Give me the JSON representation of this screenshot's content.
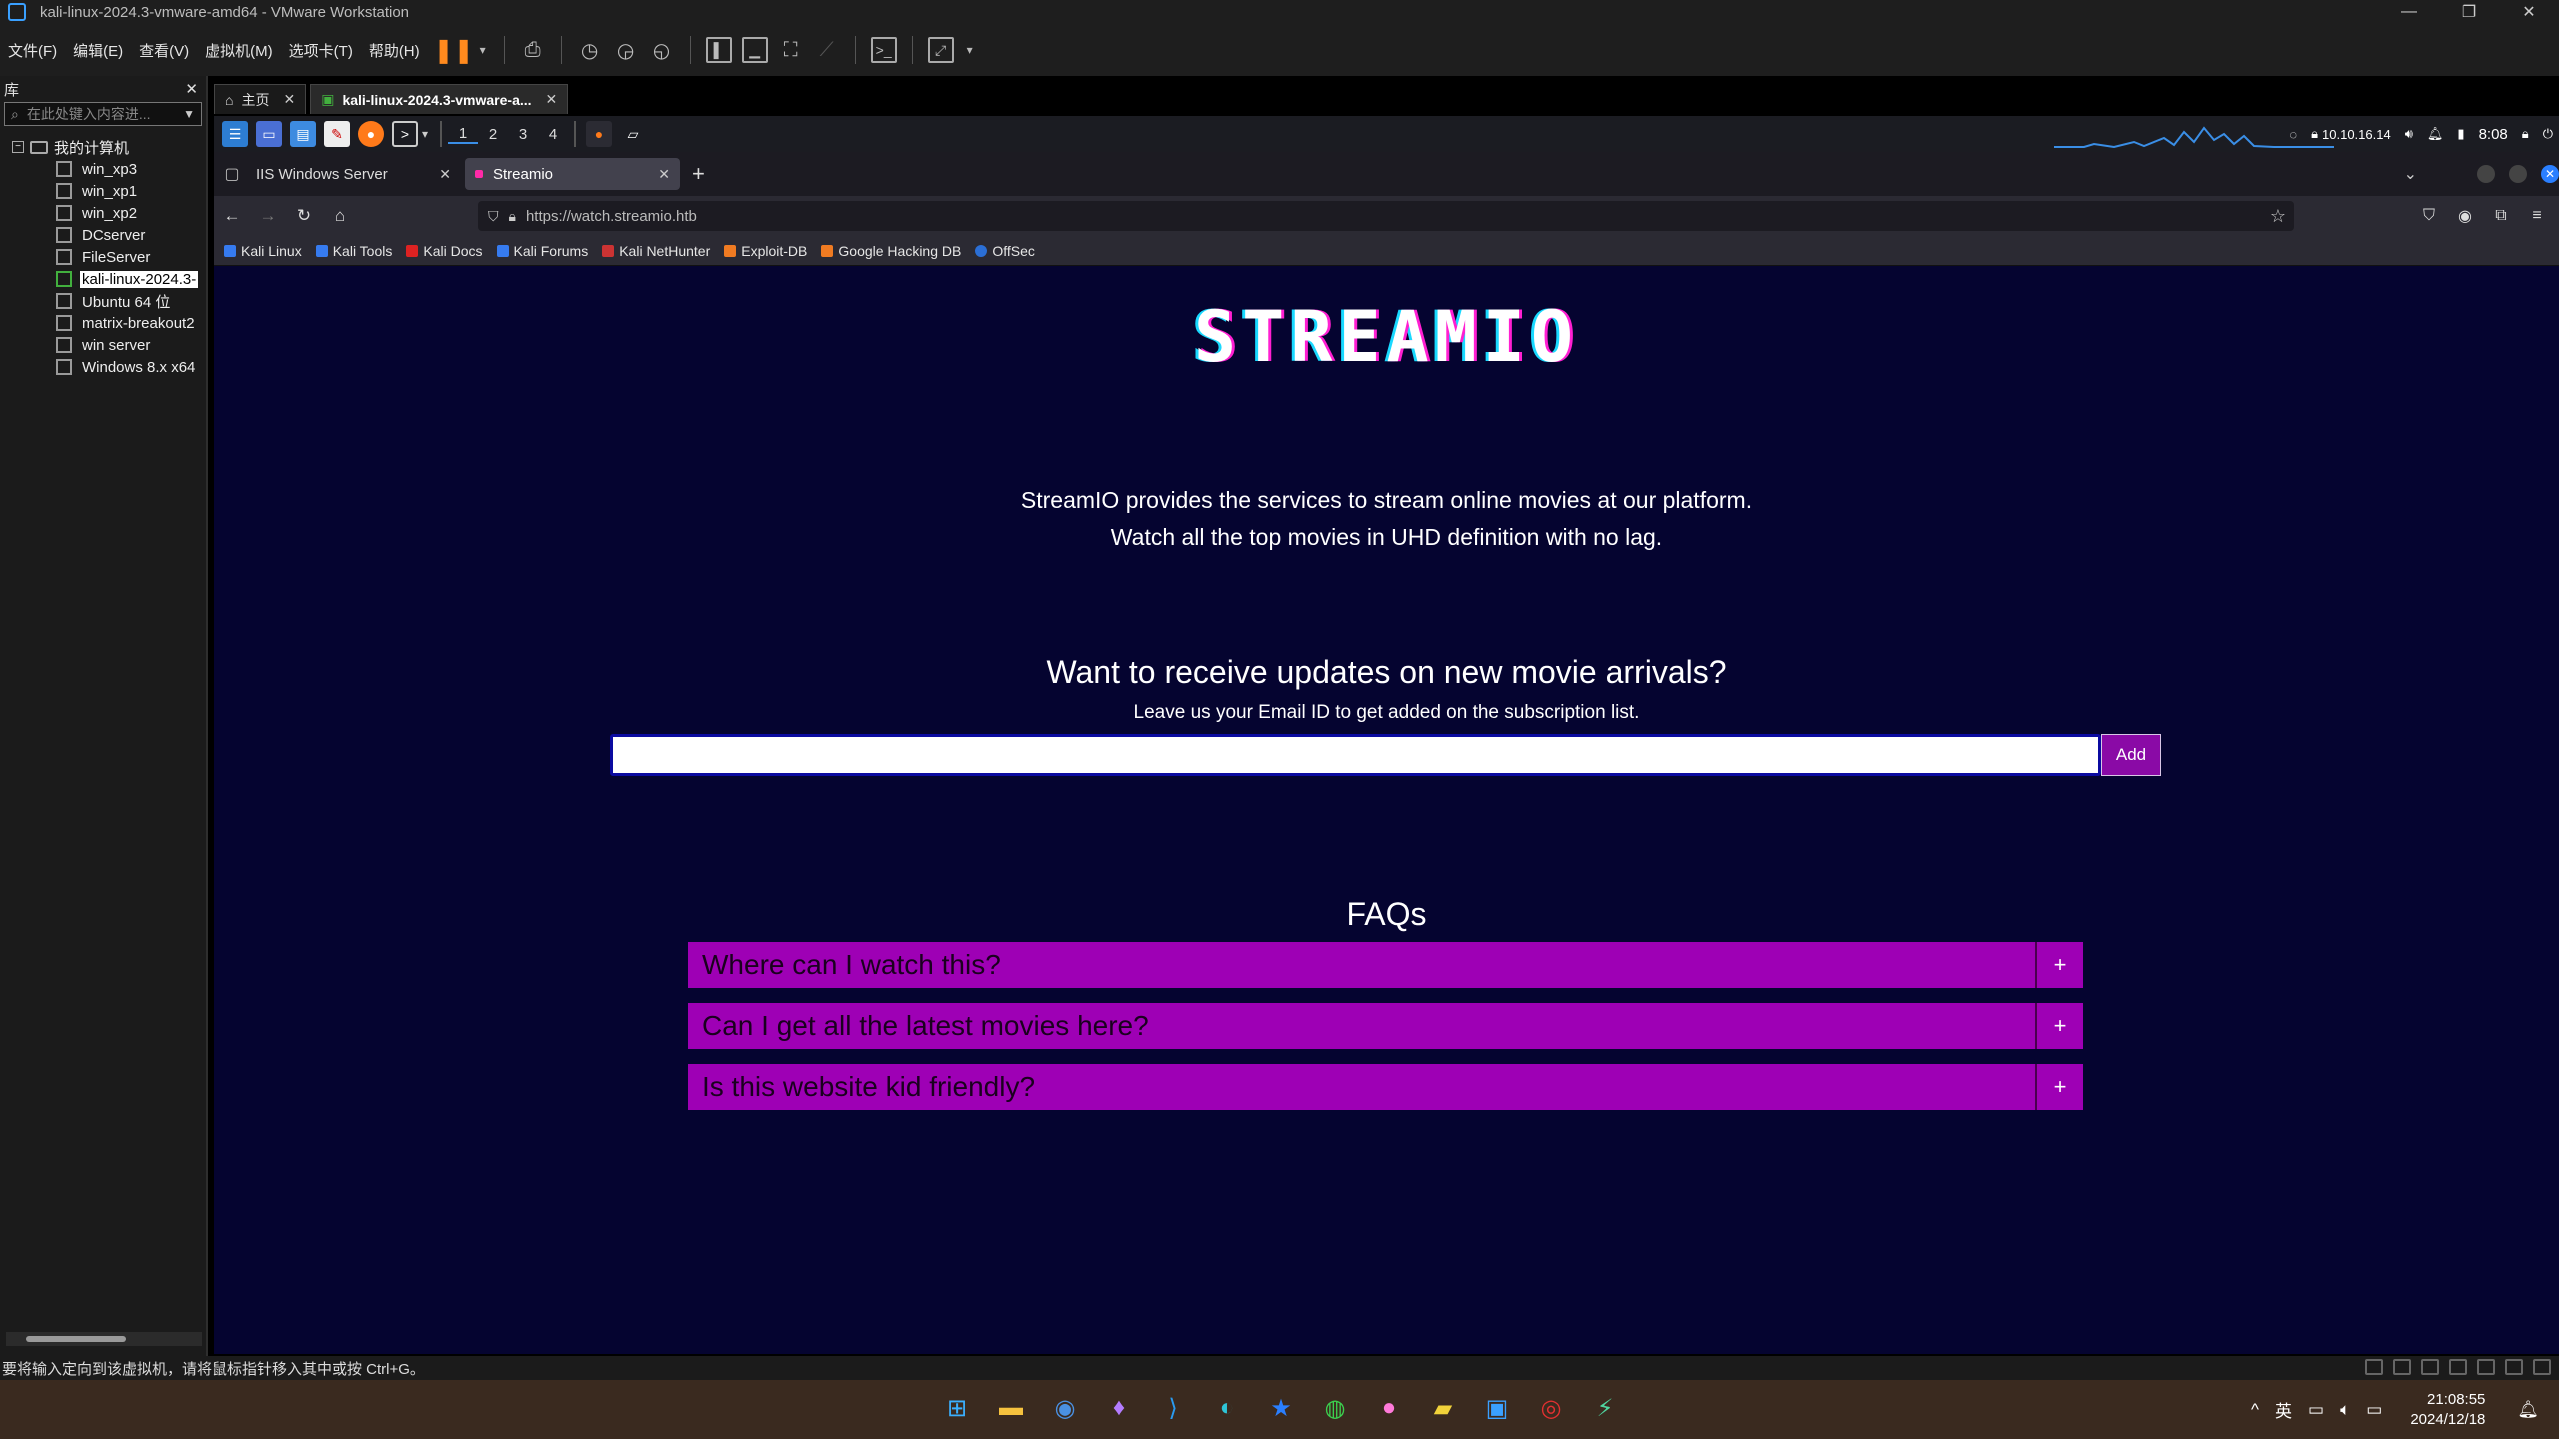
{
  "vmware": {
    "window_title": "kali-linux-2024.3-vmware-amd64 - VMware Workstation",
    "menu": [
      "文件(F)",
      "编辑(E)",
      "查看(V)",
      "虚拟机(M)",
      "选项卡(T)",
      "帮助(H)"
    ],
    "library": {
      "title": "库",
      "search_placeholder": "在此处键入内容进...",
      "root": "我的计算机",
      "vms": [
        "win_xp3",
        "win_xp1",
        "win_xp2",
        "DCserver",
        "FileServer",
        "kali-linux-2024.3-",
        "Ubuntu 64 位",
        "matrix-breakout2",
        "win server",
        "Windows 8.x x64"
      ],
      "selected_index": 5
    },
    "tabs": [
      "主页",
      "kali-linux-2024.3-vmware-a..."
    ],
    "status_text": "要将输入定向到该虚拟机，请将鼠标指针移入其中或按 Ctrl+G。"
  },
  "kali_panel": {
    "workspaces": [
      "1",
      "2",
      "3",
      "4"
    ],
    "ip": "10.10.16.14",
    "time": "8:08"
  },
  "browser": {
    "tabs": [
      "IIS Windows Server",
      "Streamio"
    ],
    "url": "https://watch.streamio.htb",
    "bookmarks": [
      "Kali Linux",
      "Kali Tools",
      "Kali Docs",
      "Kali Forums",
      "Kali NetHunter",
      "Exploit-DB",
      "Google Hacking DB",
      "OffSec"
    ]
  },
  "page": {
    "logo": "STREAMIO",
    "intro_line1": "StreamIO provides the services to stream online movies at our platform.",
    "intro_line2": "Watch all the top movies in UHD definition with no lag.",
    "updates_heading": "Want to receive updates on new movie arrivals?",
    "updates_text": "Leave us your Email ID to get added on the subscription list.",
    "email_value": "",
    "add_label": "Add",
    "faq_title": "FAQs",
    "faqs": [
      "Where can I watch this?",
      "Can I get all the latest movies here?",
      "Is this website kid friendly?"
    ],
    "faq_toggle": "+"
  },
  "taskbar": {
    "lang": "英",
    "time": "21:08:55",
    "date": "2024/12/18"
  },
  "colors": {
    "page_bg": "#050430",
    "faq_bg": "#9e00b5",
    "add_button": "#8a0aa6"
  }
}
